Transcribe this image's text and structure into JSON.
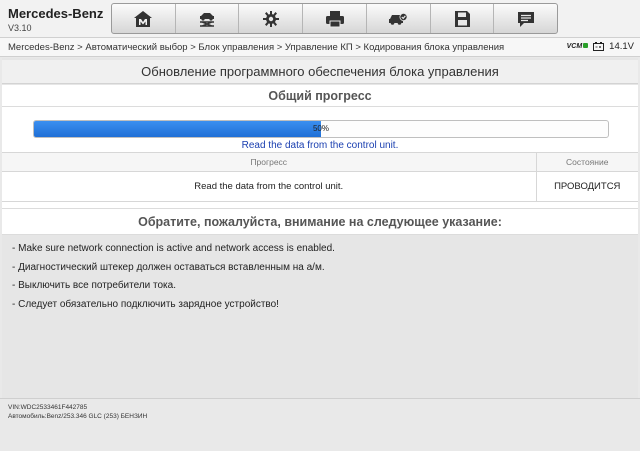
{
  "app": {
    "name": "Mercedes-Benz",
    "version": "V3.10"
  },
  "toolbar": {
    "buttons": [
      {
        "icon": "home-icon"
      },
      {
        "icon": "vehicle-lift-icon"
      },
      {
        "icon": "gear-icon"
      },
      {
        "icon": "printer-icon"
      },
      {
        "icon": "car-check-icon"
      },
      {
        "icon": "save-icon"
      },
      {
        "icon": "message-icon"
      }
    ]
  },
  "breadcrumb": "Mercedes-Benz > Автоматический выбор > Блок управления > Управление КП > Кодирования блока управления",
  "status": {
    "vcm_label": "VCM",
    "voltage": "14.1V"
  },
  "page": {
    "title": "Обновление программного обеспечения блока управления"
  },
  "progress": {
    "heading": "Общий прогресс",
    "percent": 50,
    "label": "50%",
    "caption": "Read the data from the control unit.",
    "table": {
      "headers": [
        "Прогресс",
        "Состояние"
      ],
      "rows": [
        [
          "Read the data from the control unit.",
          "ПРОВОДИТСЯ"
        ]
      ]
    }
  },
  "notice": {
    "heading": "Обратите, пожалуйста, внимание на следующее указание:",
    "items": [
      "- Make sure network connection is active and network access is enabled.",
      "- Диагностический штекер должен оставаться вставленным на а/м.",
      "- Выключить все потребители тока.",
      "- Следует обязательно подключить зарядное устройство!"
    ]
  },
  "footer": {
    "vin": "VIN:WDC2533461F442785",
    "vehicle": "Автомобиль:Benz/253.346 GLC (253) БЕНЗИН"
  },
  "colors": {
    "progress_fill": "#2a7fe6",
    "caption": "#1a3fb0"
  }
}
